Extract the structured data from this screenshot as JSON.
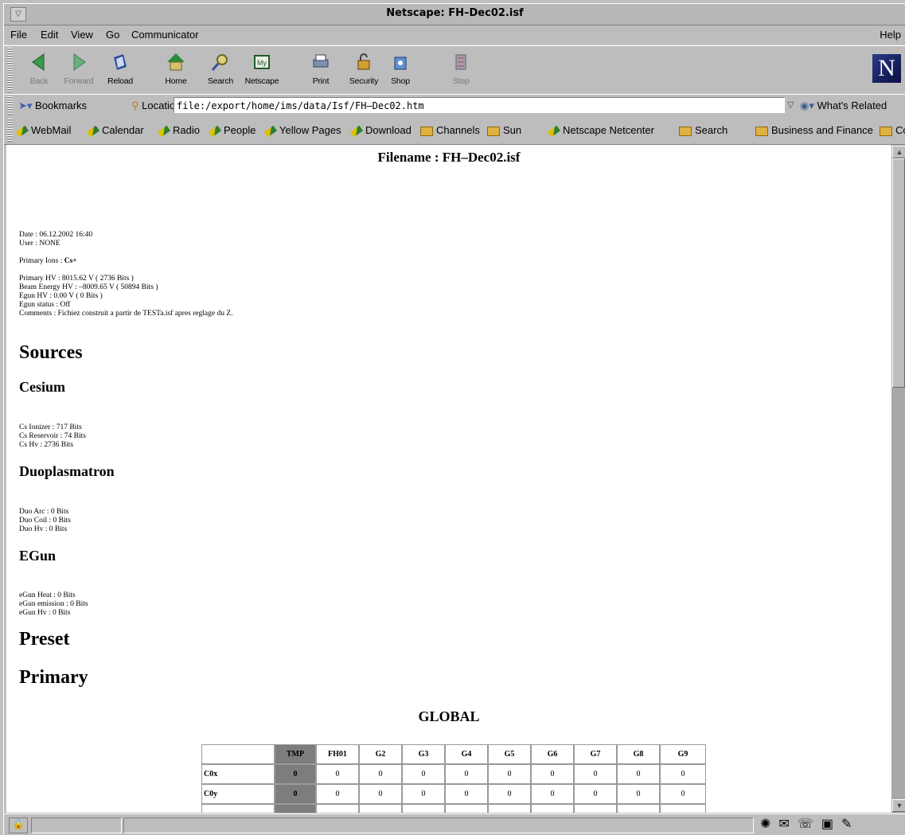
{
  "window": {
    "title": "Netscape: FH–Dec02.isf"
  },
  "menubar": {
    "file": "File",
    "edit": "Edit",
    "view": "View",
    "go": "Go",
    "communicator": "Communicator",
    "help": "Help"
  },
  "toolbar": {
    "back": "Back",
    "forward": "Forward",
    "reload": "Reload",
    "home": "Home",
    "search": "Search",
    "netscape": "Netscape",
    "print": "Print",
    "security": "Security",
    "shop": "Shop",
    "stop": "Stop",
    "logo": "N"
  },
  "location": {
    "bookmarks": "Bookmarks",
    "label": "Location:",
    "url": "file:/export/home/ims/data/Isf/FH–Dec02.htm",
    "related": "What's Related"
  },
  "personal": {
    "items": [
      "WebMail",
      "Calendar",
      "Radio",
      "People",
      "Yellow Pages",
      "Download",
      "Channels",
      "Sun",
      "Netscape Netcenter",
      "Search",
      "Business and Finance",
      "Co"
    ]
  },
  "page": {
    "filename": "Filename : FH–Dec02.isf",
    "date": "Date : 06.12.2002 16:40",
    "user": "User : NONE",
    "primary_ions_label": "Primary Ions : ",
    "primary_ions_value": "Cs+",
    "primary_hv": "Primary HV : 8015.62 V ( 2736 Bits )",
    "beam_energy_hv": "Beam Energy HV : –8009.65 V ( 50894 Bits )",
    "egun_hv": "Egun HV : 0.00 V ( 0 Bits )",
    "egun_status": "Egun status : Off",
    "comments": "Comments : Fichiez construit a partir de TESTa.isf apres reglage du Z.",
    "sources": "Sources",
    "cesium": "Cesium",
    "cs_ionizer": "Cs Ionizer : 717 Bits",
    "cs_reservoir": "Cs Reservoir : 74 Bits",
    "cs_hv": "Cs Hv : 2736 Bits",
    "duoplasmatron": "Duoplasmatron",
    "duo_arc": "Duo Arc : 0 Bits",
    "duo_coil": "Duo Coil : 0 Bits",
    "duo_hv": "Duo Hv : 0 Bits",
    "egun": "EGun",
    "egun_heat": "eGun Heat : 0 Bits",
    "egun_emission": "eGun emission : 0 Bits",
    "egun_hv_bits": "eGun Hv : 0 Bits",
    "preset": "Preset",
    "primary": "Primary",
    "global_title": "GLOBAL"
  },
  "table": {
    "headers": [
      "",
      "TMP",
      "FH01",
      "G2",
      "G3",
      "G4",
      "G5",
      "G6",
      "G7",
      "G8",
      "G9"
    ],
    "rows": [
      {
        "label": "C0x",
        "values": [
          "0",
          "0",
          "0",
          "0",
          "0",
          "0",
          "0",
          "0",
          "0",
          "0"
        ]
      },
      {
        "label": "C0y",
        "values": [
          "0",
          "0",
          "0",
          "0",
          "0",
          "0",
          "0",
          "0",
          "0",
          "0"
        ]
      }
    ]
  }
}
